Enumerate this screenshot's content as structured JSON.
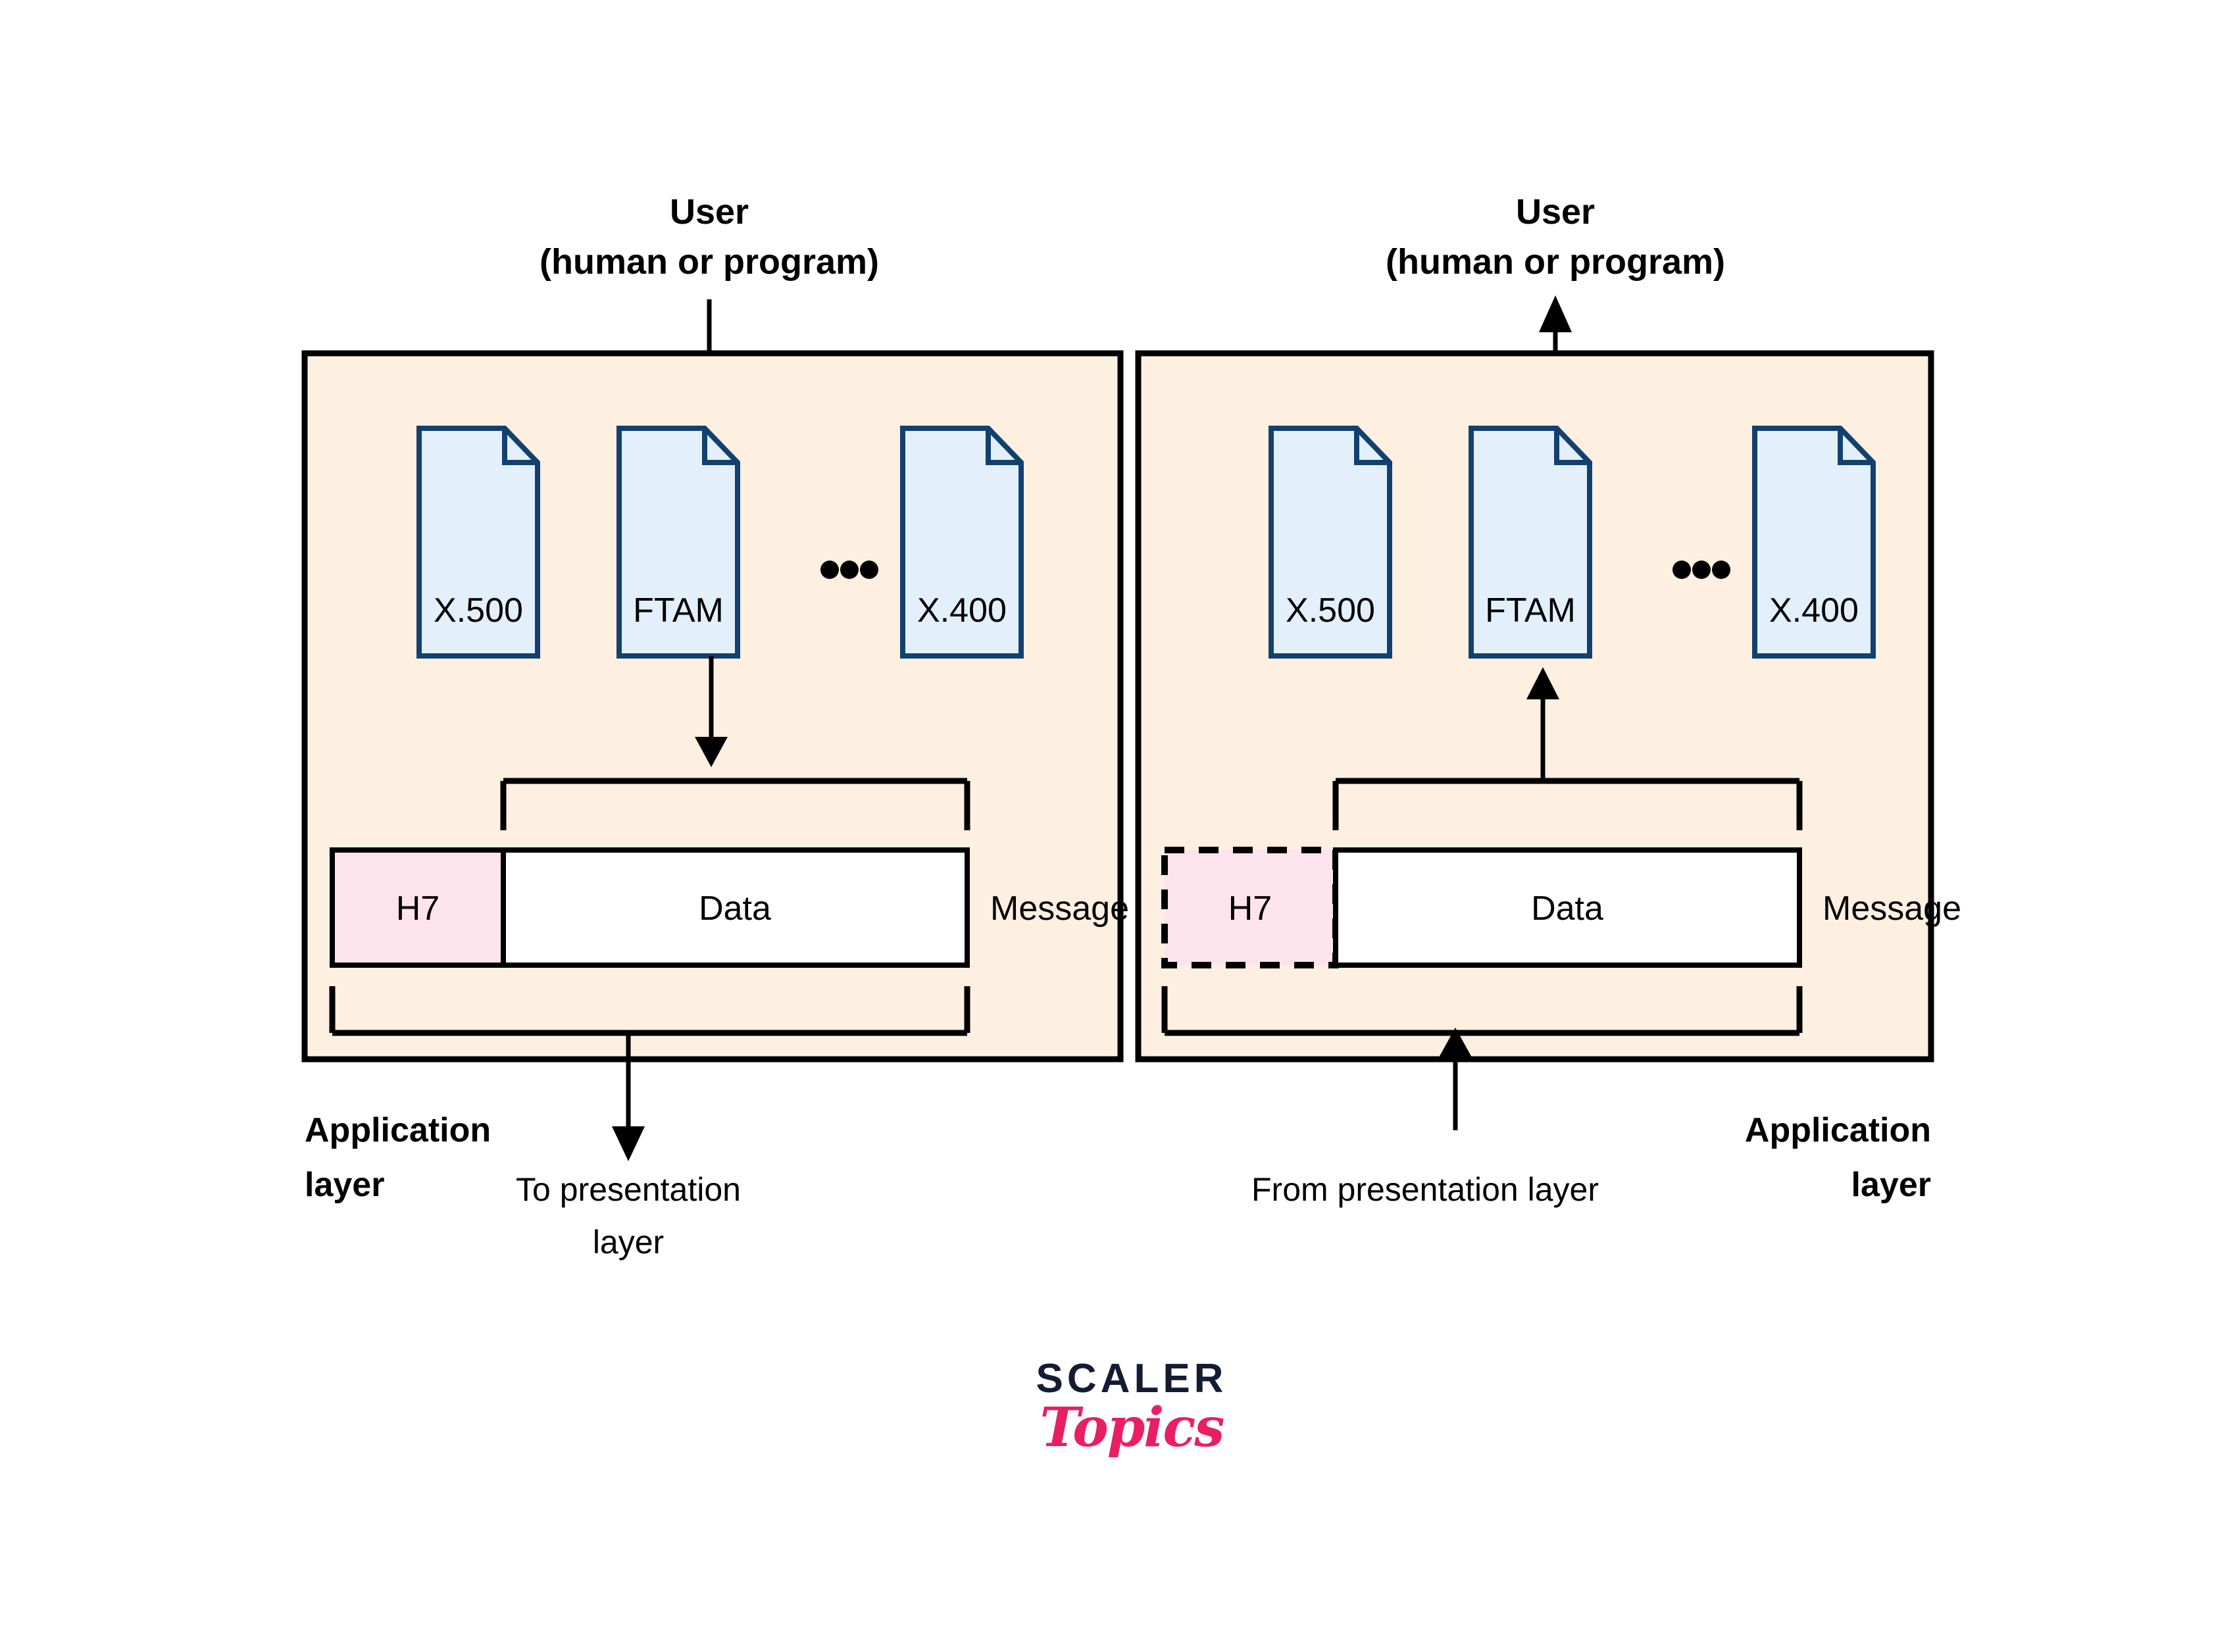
{
  "diagram": {
    "title": "OSI Application Layer encapsulation and decapsulation",
    "colors": {
      "panel_fill": "#fdf0e0",
      "panel_stroke": "#000000",
      "doc_fill": "#e3f0fc",
      "doc_stroke": "#12416f",
      "header_fill": "#fde3ec",
      "data_fill": "#ffffff",
      "line": "#000000",
      "logo_dark": "#141b34",
      "logo_pink": "#e91e63",
      "background": "#ffffff"
    },
    "left_panel": {
      "user_label_line1": "User",
      "user_label_line2": "(human or program)",
      "documents": [
        {
          "label": "X.500"
        },
        {
          "label": "FTAM"
        },
        {
          "label": "X.400"
        }
      ],
      "ellipsis": "•••",
      "message": {
        "header_label": "H7",
        "data_label": "Data",
        "message_label": "Message",
        "header_border": "solid"
      },
      "layer_label_line1": "Application",
      "layer_label_line2": "layer",
      "flow_note_line1": "To presentation",
      "flow_note_line2": "layer",
      "user_arrow_direction": "down",
      "doc_arrow_direction": "down",
      "layer_arrow_direction": "down"
    },
    "right_panel": {
      "user_label_line1": "User",
      "user_label_line2": "(human or program)",
      "documents": [
        {
          "label": "X.500"
        },
        {
          "label": "FTAM"
        },
        {
          "label": "X.400"
        }
      ],
      "ellipsis": "•••",
      "message": {
        "header_label": "H7",
        "data_label": "Data",
        "message_label": "Message",
        "header_border": "dashed"
      },
      "layer_label_line1": "Application",
      "layer_label_line2": "layer",
      "flow_note_line1": "From presentation layer",
      "flow_note_line2": "",
      "user_arrow_direction": "up",
      "doc_arrow_direction": "up",
      "layer_arrow_direction": "up"
    },
    "logo": {
      "primary": "SCALER",
      "secondary": "Topics"
    }
  }
}
